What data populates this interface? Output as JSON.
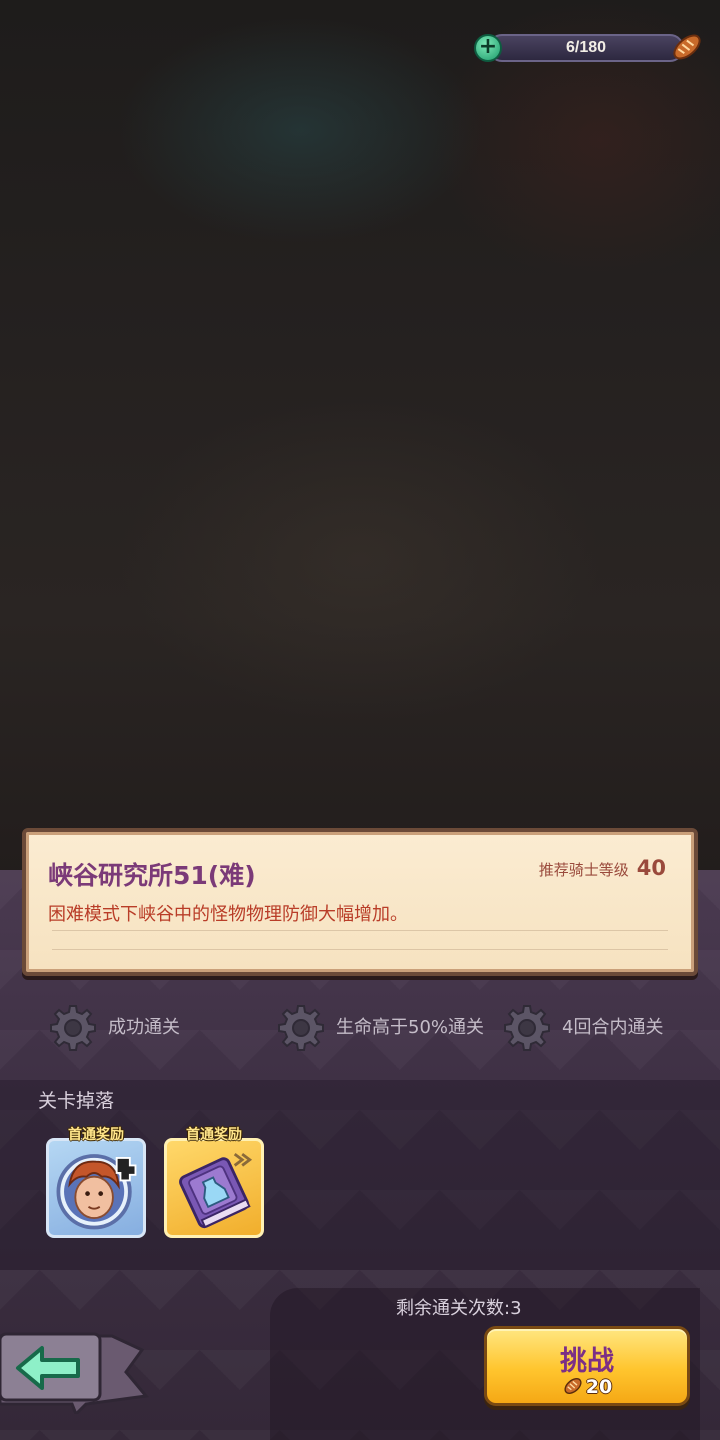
{
  "energy": {
    "value": "6/180",
    "icon": "bread-icon"
  },
  "stage": {
    "title": "峡谷研究所51(难)",
    "recommended_label": "推荐骑士等级",
    "recommended_level": "40",
    "description": "困难模式下峡谷中的怪物物理防御大幅增加。"
  },
  "objectives": [
    {
      "label": "成功通关",
      "icon": "gear-icon"
    },
    {
      "label": "生命高于50%通关",
      "icon": "gear-icon"
    },
    {
      "label": "4回合内通关",
      "icon": "gear-icon"
    }
  ],
  "drops": {
    "title": "关卡掉落",
    "items": [
      {
        "tag": "首通奖励",
        "icon": "hero-portrait-icon"
      },
      {
        "tag": "首通奖励",
        "icon": "spellbook-icon"
      }
    ]
  },
  "remaining": "剩余通关次数:3",
  "challenge": {
    "label": "挑战",
    "cost": "20"
  },
  "colors": {
    "title": "#7b3a78",
    "description": "#b93d28",
    "button": "#ffc52e"
  }
}
